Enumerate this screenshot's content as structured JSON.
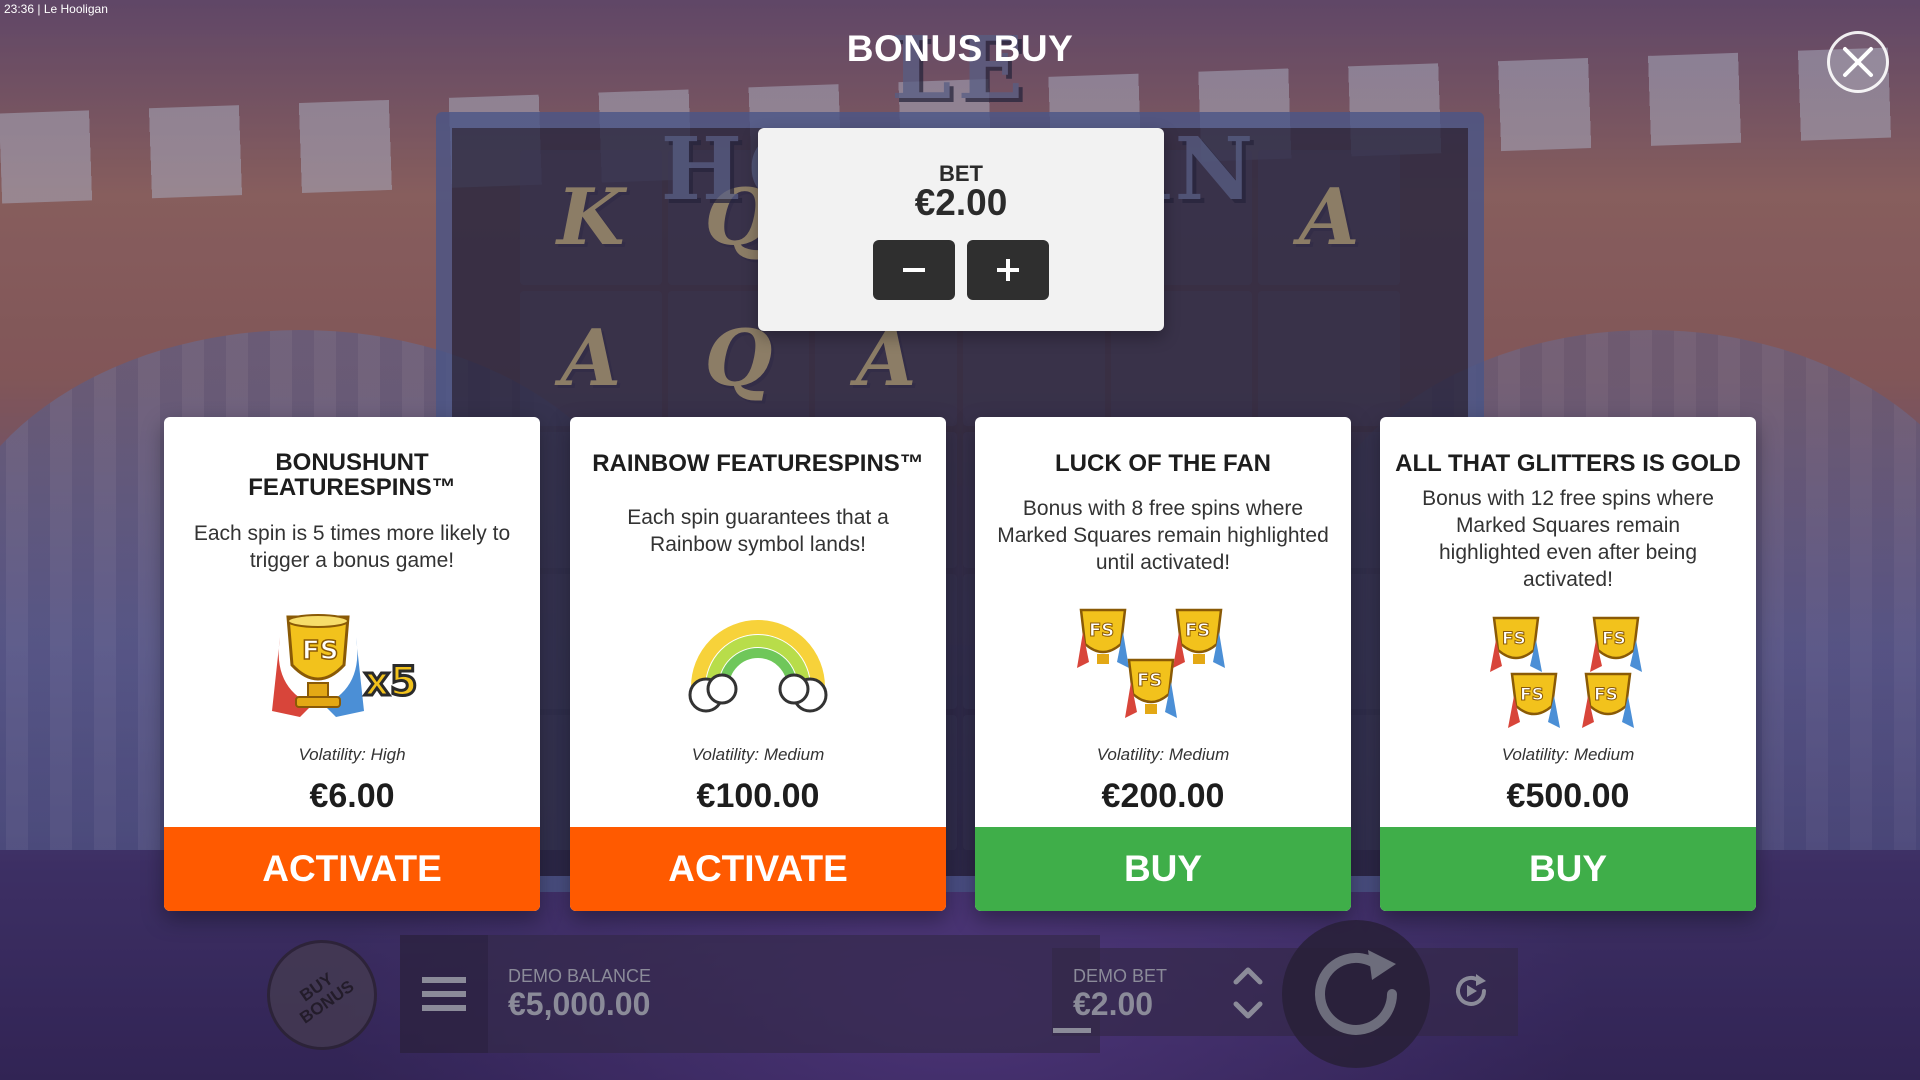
{
  "window": {
    "title": "23:36 | Le Hooligan"
  },
  "background": {
    "logo_text": "LE HOOLIGAN",
    "reel_symbols": [
      "K",
      "Q",
      "",
      "",
      "",
      "A",
      "A",
      "Q",
      "A",
      "",
      "",
      "",
      "",
      "",
      "",
      "",
      "",
      "",
      "",
      "",
      "",
      "",
      "",
      "",
      "",
      "",
      "",
      "",
      "",
      ""
    ]
  },
  "header": {
    "title": "BONUS BUY",
    "close_icon": "close-icon"
  },
  "bet": {
    "label": "BET",
    "value": "€2.00",
    "minus_icon": "minus-icon",
    "plus_icon": "plus-icon"
  },
  "cards": [
    {
      "title": "BONUSHUNT FEATURESPINS™",
      "description": "Each spin is 5 times more likely to trigger a bonus game!",
      "art_icon": "trophy-x5-icon",
      "art_label": "x5",
      "volatility": "Volatility: High",
      "price": "€6.00",
      "button": "ACTIVATE",
      "button_color": "#ff5a00"
    },
    {
      "title": "RAINBOW FEATURESPINS™",
      "description": "Each spin guarantees that a Rainbow symbol lands!",
      "art_icon": "rainbow-icon",
      "volatility": "Volatility: Medium",
      "price": "€100.00",
      "button": "ACTIVATE",
      "button_color": "#ff5a00"
    },
    {
      "title": "LUCK OF THE FAN",
      "description": "Bonus with 8 free spins where Marked Squares remain highlighted until activated!",
      "art_icon": "three-trophies-icon",
      "volatility": "Volatility: Medium",
      "price": "€200.00",
      "button": "BUY",
      "button_color": "#3fae49"
    },
    {
      "title": "ALL THAT GLITTERS IS GOLD",
      "description": "Bonus with 12 free spins where Marked Squares remain highlighted even after being activated!",
      "art_icon": "four-trophies-icon",
      "volatility": "Volatility: Medium",
      "price": "€500.00",
      "button": "BUY",
      "button_color": "#3fae49"
    }
  ],
  "bottom_bar": {
    "buy_bonus_line1": "BUY",
    "buy_bonus_line2": "BONUS",
    "menu_icon": "hamburger-menu-icon",
    "demo_balance_label": "DEMO BALANCE",
    "demo_balance_value": "€5,000.00",
    "demo_bet_label": "DEMO BET",
    "demo_bet_value": "€2.00",
    "stepper_icon": "up-down-chevron-icon",
    "spin_icon": "spin-arrow-icon",
    "autoplay_icon": "autoplay-icon"
  },
  "colors": {
    "activate": "#ff5a00",
    "buy": "#3fae49",
    "panel": "#f2f2f2",
    "dark_button": "#2f2f2f"
  }
}
